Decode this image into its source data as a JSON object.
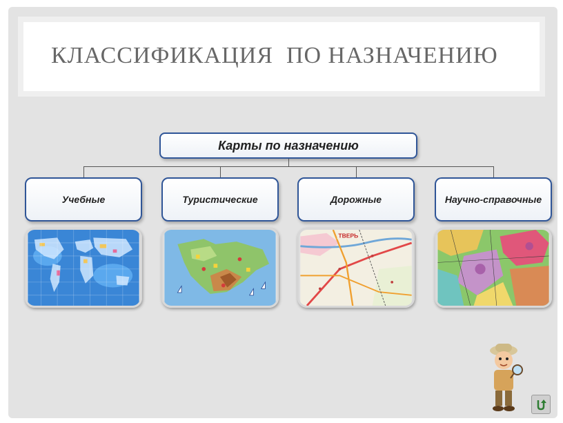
{
  "slide": {
    "title": "КЛАССИФИКАЦИЯ  ПО НАЗНАЧЕНИЮ"
  },
  "diagram": {
    "root": "Карты по назначению",
    "categories": [
      {
        "label": "Учебные",
        "image": "world-map"
      },
      {
        "label": "Туристические",
        "image": "crimea-tourist-map"
      },
      {
        "label": "Дорожные",
        "image": "road-map"
      },
      {
        "label": "Научно-справочные",
        "image": "geological-map"
      }
    ]
  },
  "road_map_labels": {
    "city": "ТВЕРЬ"
  },
  "icons": {
    "mascot": "explorer-boy-with-magnifier",
    "return": "return-arrow-icon"
  }
}
